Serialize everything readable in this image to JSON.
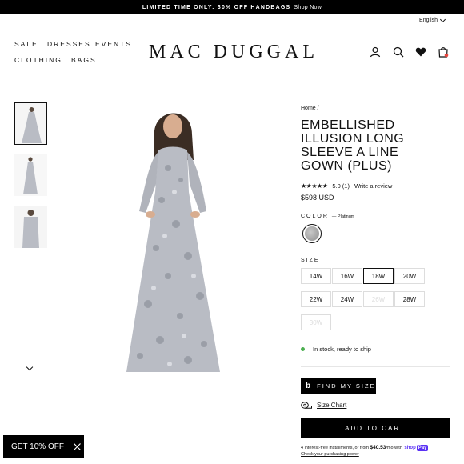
{
  "announcement": {
    "text": "LIMITED TIME ONLY: 30% OFF HANDBAGS",
    "link": "Shop Now"
  },
  "language": "English",
  "nav": {
    "items": [
      "SALE",
      "DRESSES",
      "EVENTS",
      "CLOTHING",
      "BAGS"
    ]
  },
  "logo": "MAC DUGGAL",
  "header_icons": [
    "account-icon",
    "search-icon",
    "heart-icon",
    "cart-icon"
  ],
  "product": {
    "breadcrumb": [
      "Home",
      "/"
    ],
    "title": "EMBELLISHED ILLUSION LONG SLEEVE A LINE GOWN (PLUS)",
    "stars": "★★★★★",
    "rating": "5.0",
    "review_count": "(1)",
    "write_review": "Write a review",
    "price": "$598 USD",
    "color_label": "COLOR",
    "color_value": "— Platinum",
    "size_label": "SIZE",
    "sizes": [
      {
        "label": "14W",
        "available": true,
        "selected": false
      },
      {
        "label": "16W",
        "available": true,
        "selected": false
      },
      {
        "label": "18W",
        "available": true,
        "selected": true
      },
      {
        "label": "20W",
        "available": true,
        "selected": false
      },
      {
        "label": "22W",
        "available": true,
        "selected": false
      },
      {
        "label": "24W",
        "available": true,
        "selected": false
      },
      {
        "label": "26W",
        "available": false,
        "selected": false
      },
      {
        "label": "28W",
        "available": true,
        "selected": false
      },
      {
        "label": "30W",
        "available": false,
        "selected": false
      }
    ],
    "stock_text": "In stock, ready to ship",
    "find_my_size": "FIND MY SIZE",
    "size_chart": "Size Chart",
    "add_to_cart": "ADD TO CART",
    "installments_text": "4 interest-free installments, or from",
    "installments_amount": "$40.53",
    "installments_suffix": "/mo with",
    "shop_word": "shop",
    "pay_word": "Pay",
    "check_power": "Check your purchasing power"
  },
  "promo": {
    "label": "GET 10% OFF"
  },
  "colors": {
    "stock_dot": "#4caf50",
    "shoppay": "#5a31f4",
    "dress": "#b9bcc4"
  }
}
